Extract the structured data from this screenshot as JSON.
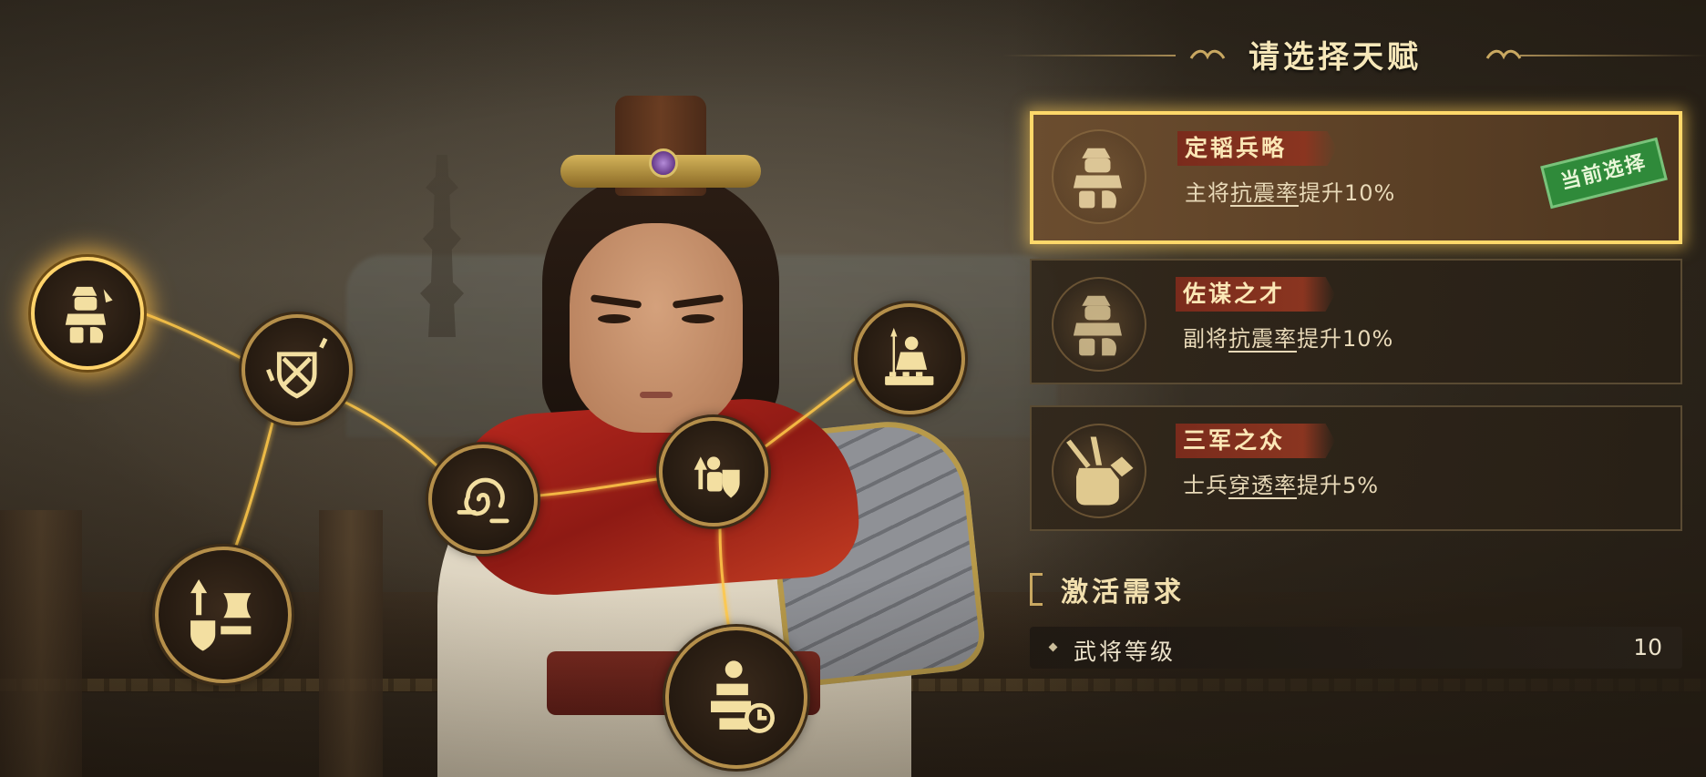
{
  "panel": {
    "title": "请选择天赋"
  },
  "talents": [
    {
      "name": "定韬兵略",
      "desc_prefix": "主将",
      "desc_stat": "抗震率",
      "desc_suffix": "提升10%",
      "selected": true,
      "badge": "当前选择",
      "icon": "armored-general-icon"
    },
    {
      "name": "佐谋之才",
      "desc_prefix": "副将",
      "desc_stat": "抗震率",
      "desc_suffix": "提升10%",
      "selected": false,
      "icon": "armored-general-icon"
    },
    {
      "name": "三军之众",
      "desc_prefix": "士兵",
      "desc_stat": "穿透率",
      "desc_suffix": "提升5%",
      "selected": false,
      "icon": "fist-arrows-icon"
    }
  ],
  "requirements": {
    "title": "激活需求",
    "rows": [
      {
        "label": "武将等级",
        "value": "10"
      }
    ]
  },
  "tree_nodes": [
    {
      "name": "armored-general-icon",
      "active": true
    },
    {
      "name": "shield-crossed-swords-icon",
      "active": false
    },
    {
      "name": "swirl-wind-icon",
      "active": false
    },
    {
      "name": "soldier-shield-up-icon",
      "active": false
    },
    {
      "name": "spear-soldier-icon",
      "active": false
    },
    {
      "name": "helmet-banner-icon",
      "active": false
    },
    {
      "name": "runner-clock-icon",
      "active": false
    }
  ],
  "colors": {
    "gold": "#ffd36a",
    "badge_green": "#2f8a3a",
    "name_banner": "#7a2b1c"
  }
}
